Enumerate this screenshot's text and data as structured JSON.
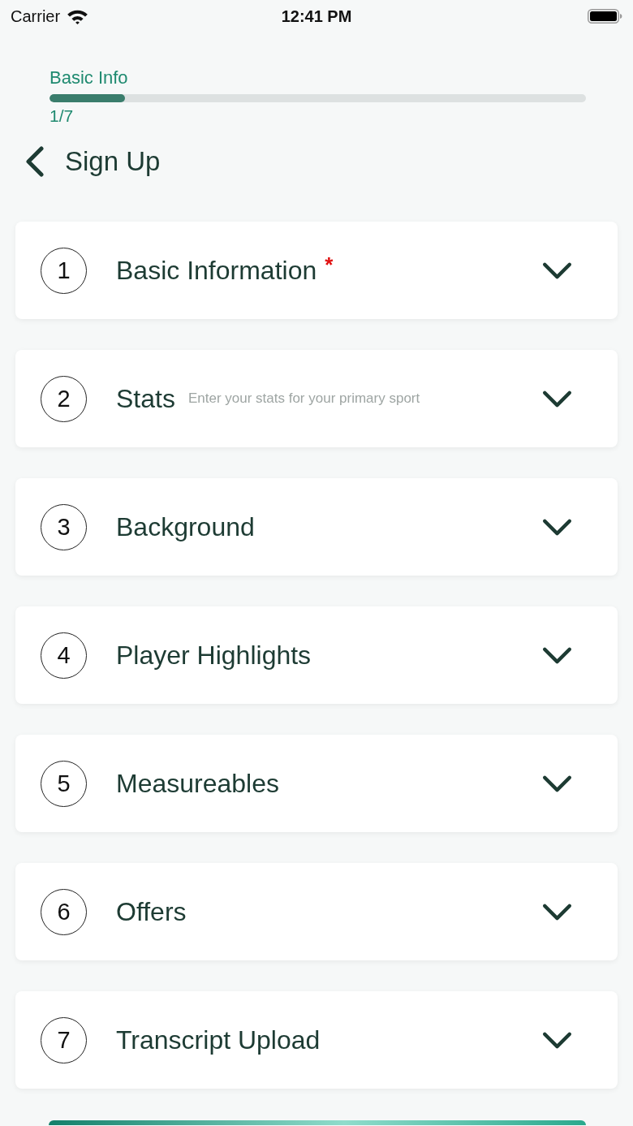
{
  "status_bar": {
    "carrier": "Carrier",
    "time": "12:41 PM"
  },
  "progress": {
    "label": "Basic Info",
    "level": 0.14,
    "count": "1/7"
  },
  "header": {
    "title": "Sign Up"
  },
  "sections": [
    {
      "number": "1",
      "title": "Basic Information",
      "required_mark": "*",
      "expanded": false
    },
    {
      "number": "2",
      "title": "Stats",
      "hint": "Enter your stats for your primary sport",
      "expanded": false
    },
    {
      "number": "3",
      "title": "Background",
      "expanded": false
    },
    {
      "number": "4",
      "title": "Player Highlights",
      "expanded": false
    },
    {
      "number": "5",
      "title": "Measureables",
      "expanded": false
    },
    {
      "number": "6",
      "title": "Offers",
      "expanded": false
    },
    {
      "number": "7",
      "title": "Transcript Upload",
      "expanded": false
    }
  ]
}
